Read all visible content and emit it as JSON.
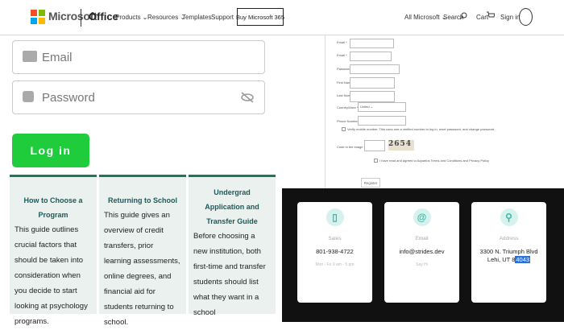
{
  "nav": {
    "brand": "Microsoft",
    "product": "Office",
    "links": [
      "Products ⌄",
      "Resources ⌄",
      "Templates",
      "Support"
    ],
    "buy_label": "Buy Microsoft 365",
    "all_microsoft": "All Microsoft ⌄",
    "search": "Search",
    "cart": "Cart",
    "signin": "Sign in",
    "logo_colors": [
      "#f25022",
      "#7fba00",
      "#00a4ef",
      "#ffb900"
    ]
  },
  "login": {
    "email_placeholder": "Email",
    "password_placeholder": "Password",
    "login_label": "Log in"
  },
  "guides": [
    {
      "title": "How to Choose a Program",
      "body": "This guide outlines crucial factors that should be taken into consideration when you decide to start looking at psychology programs."
    },
    {
      "title": "Returning to School",
      "body": "This guide gives an overview of credit transfers, prior learning assessments, online degrees, and financial aid for students returning to school."
    },
    {
      "title": "Undergrad Application and Transfer Guide",
      "body": "Before choosing a new institution, both first-time and transfer students should list what they want in a school"
    }
  ],
  "registration": {
    "labels": [
      "Email *",
      "Email *",
      "Password *",
      "First Name *",
      "Last Name *",
      "Country/Area *",
      "Phone Number"
    ],
    "country_value": "United",
    "verify_text": "Verify mobile number. This uses one a verified number to log in, reset password, and change password.",
    "captcha_label": "Code in the image *",
    "captcha_code": "2654",
    "terms_text": "I have read and agreed to Aquarius Terms and Conditions and Privacy Policy",
    "register_label": "Register"
  },
  "contacts": [
    {
      "icon": "phone-icon",
      "label": "Sales",
      "value": "801-938-4722",
      "sub": "Mon - Fri 9 am - 5 pm"
    },
    {
      "icon": "at-icon",
      "label": "Email",
      "value": "info@strides.dev",
      "sub": "Say Hi"
    },
    {
      "icon": "location-pin-icon",
      "label": "Address",
      "value_line1": "3300 N. Triumph Blvd",
      "value_line2_pre": "Lehi, UT 8",
      "value_line2_sel": "4043",
      "sub": ""
    }
  ]
}
